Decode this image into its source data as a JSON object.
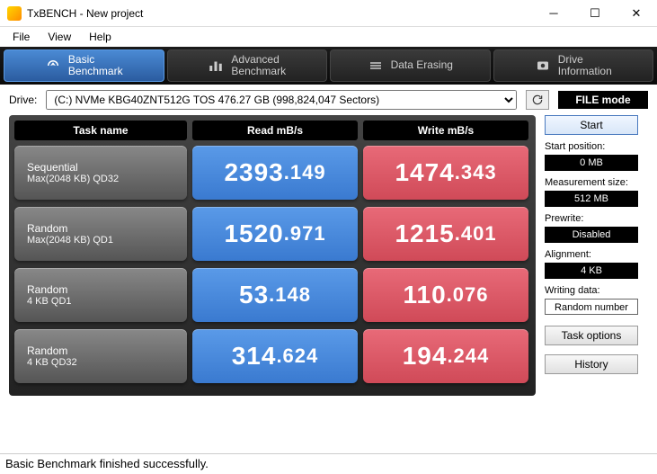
{
  "window": {
    "title": "TxBENCH - New project"
  },
  "menu": [
    "File",
    "View",
    "Help"
  ],
  "tabs": [
    {
      "line1": "Basic",
      "line2": "Benchmark",
      "icon": "gauge"
    },
    {
      "line1": "Advanced",
      "line2": "Benchmark",
      "icon": "bars"
    },
    {
      "line1": "Data Erasing",
      "line2": "",
      "icon": "erase"
    },
    {
      "line1": "Drive",
      "line2": "Information",
      "icon": "info"
    }
  ],
  "drive": {
    "label": "Drive:",
    "selected": "(C:) NVMe KBG40ZNT512G TOS  476.27 GB (998,824,047 Sectors)"
  },
  "filemode_label": "FILE mode",
  "headers": {
    "task": "Task name",
    "read": "Read mB/s",
    "write": "Write mB/s"
  },
  "rows": [
    {
      "name1": "Sequential",
      "name2": "Max(2048 KB) QD32",
      "read_int": "2393",
      "read_dec": ".149",
      "write_int": "1474",
      "write_dec": ".343"
    },
    {
      "name1": "Random",
      "name2": "Max(2048 KB) QD1",
      "read_int": "1520",
      "read_dec": ".971",
      "write_int": "1215",
      "write_dec": ".401"
    },
    {
      "name1": "Random",
      "name2": "4 KB QD1",
      "read_int": "53",
      "read_dec": ".148",
      "write_int": "110",
      "write_dec": ".076"
    },
    {
      "name1": "Random",
      "name2": "4 KB QD32",
      "read_int": "314",
      "read_dec": ".624",
      "write_int": "194",
      "write_dec": ".244"
    }
  ],
  "side": {
    "start": "Start",
    "start_pos_label": "Start position:",
    "start_pos_value": "0 MB",
    "meas_label": "Measurement size:",
    "meas_value": "512 MB",
    "prewrite_label": "Prewrite:",
    "prewrite_value": "Disabled",
    "align_label": "Alignment:",
    "align_value": "4 KB",
    "wdata_label": "Writing data:",
    "wdata_value": "Random number",
    "task_options": "Task options",
    "history": "History"
  },
  "status": "Basic Benchmark finished successfully."
}
